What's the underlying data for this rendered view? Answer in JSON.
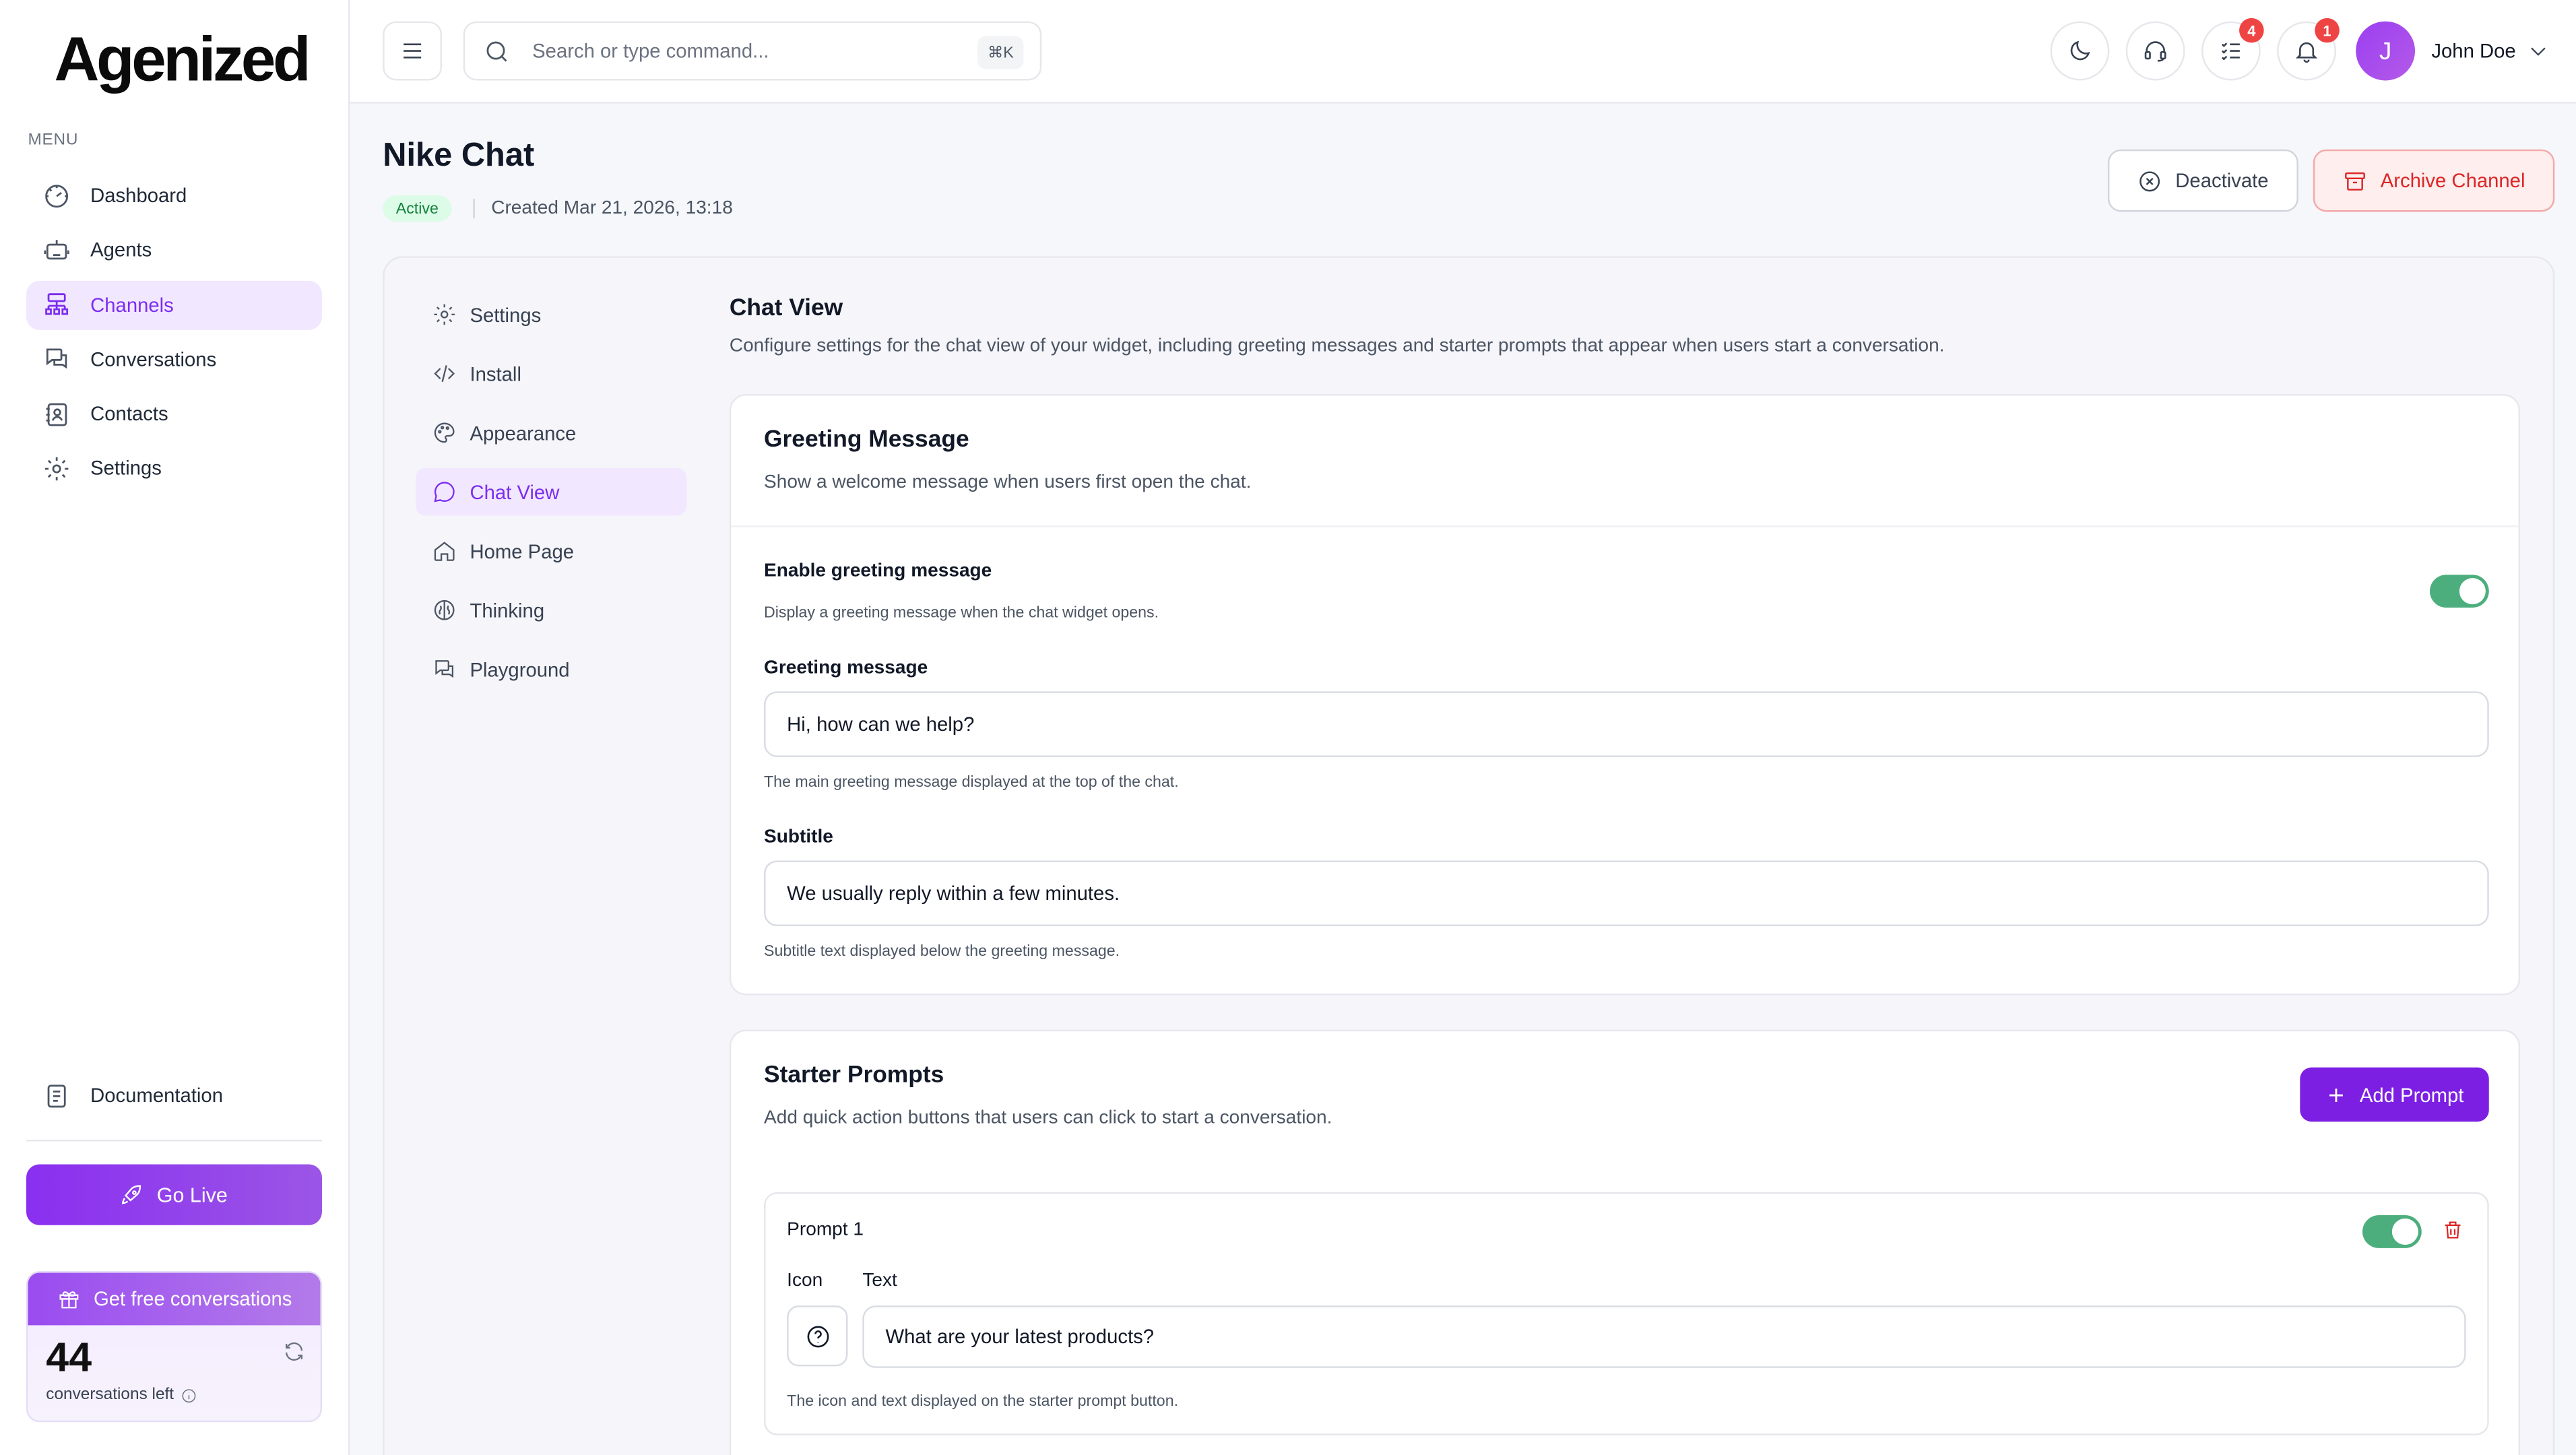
{
  "brand": {
    "logo_text": "Agenized"
  },
  "sidebar": {
    "menu_label": "MENU",
    "items": [
      {
        "label": "Dashboard",
        "icon": "dashboard-icon"
      },
      {
        "label": "Agents",
        "icon": "robot-icon"
      },
      {
        "label": "Channels",
        "icon": "channels-icon",
        "active": true
      },
      {
        "label": "Conversations",
        "icon": "conversations-icon"
      },
      {
        "label": "Contacts",
        "icon": "contacts-icon"
      },
      {
        "label": "Settings",
        "icon": "gear-icon"
      }
    ],
    "documentation_label": "Documentation",
    "go_live_label": "Go Live",
    "free": {
      "title": "Get free conversations",
      "count": "44",
      "caption": "conversations left"
    }
  },
  "topbar": {
    "search_placeholder": "Search or type command...",
    "shortcut": "⌘K",
    "tasks_badge": "4",
    "notifications_badge": "1",
    "avatar_initial": "J",
    "user_name": "John Doe"
  },
  "page": {
    "title": "Nike Chat",
    "status": "Active",
    "created": "Created Mar 21, 2026, 13:18",
    "deactivate_label": "Deactivate",
    "archive_label": "Archive Channel"
  },
  "subnav": {
    "items": [
      {
        "label": "Settings"
      },
      {
        "label": "Install"
      },
      {
        "label": "Appearance"
      },
      {
        "label": "Chat View",
        "active": true
      },
      {
        "label": "Home Page"
      },
      {
        "label": "Thinking"
      },
      {
        "label": "Playground"
      }
    ]
  },
  "chat_view": {
    "title": "Chat View",
    "description": "Configure settings for the chat view of your widget, including greeting messages and starter prompts that appear when users start a conversation."
  },
  "greeting": {
    "title": "Greeting Message",
    "description": "Show a welcome message when users first open the chat.",
    "enable_label": "Enable greeting message",
    "enable_hint": "Display a greeting message when the chat widget opens.",
    "enabled": true,
    "message_label": "Greeting message",
    "message_value": "Hi, how can we help?",
    "message_hint": "The main greeting message displayed at the top of the chat.",
    "subtitle_label": "Subtitle",
    "subtitle_value": "We usually reply within a few minutes.",
    "subtitle_hint": "Subtitle text displayed below the greeting message."
  },
  "starter": {
    "title": "Starter Prompts",
    "description": "Add quick action buttons that users can click to start a conversation.",
    "add_label": "Add Prompt",
    "prompt": {
      "name": "Prompt 1",
      "enabled": true,
      "icon_label": "Icon",
      "text_label": "Text",
      "text_value": "What are your latest products?",
      "hint": "The icon and text displayed on the starter prompt button."
    }
  },
  "colors": {
    "accent": "#7c2df0",
    "toggle_on": "#4cae7d",
    "danger": "#dc2626"
  }
}
